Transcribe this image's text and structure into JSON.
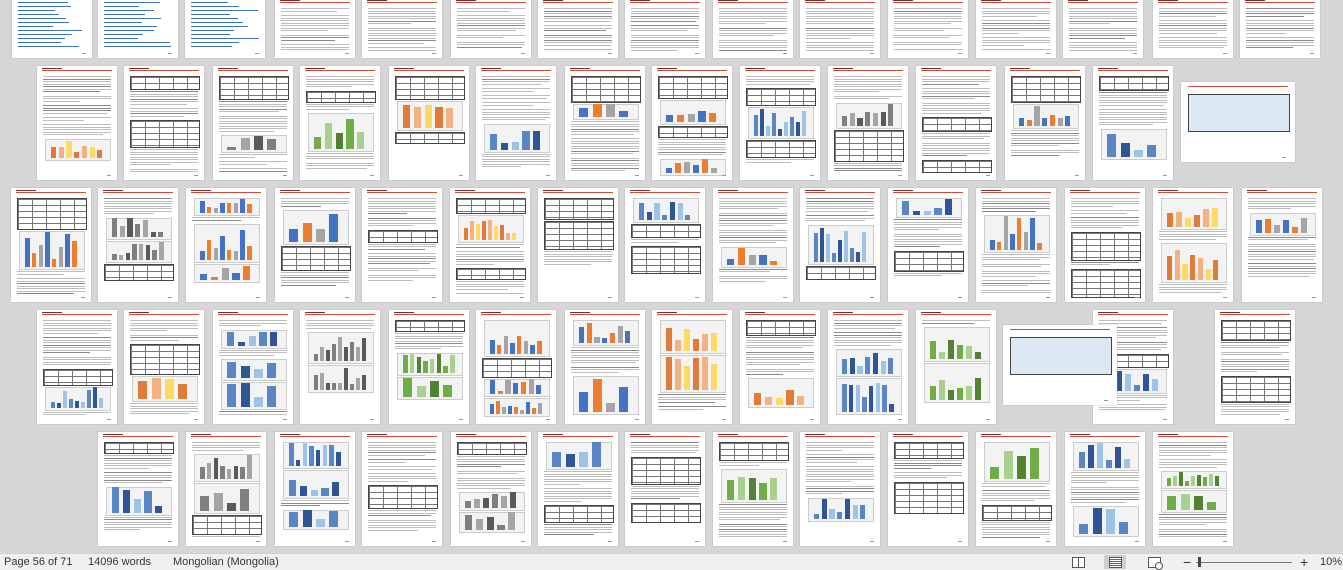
{
  "document_view": {
    "mode": "multi-page print layout",
    "accent_color": "#d04a3a"
  },
  "statusbar": {
    "page_info": "Page 56 of 71",
    "word_count": "14096 words",
    "language": "Mongolian (Mongolia)",
    "zoom_minus": "−",
    "zoom_plus": "+",
    "zoom_level": "10%",
    "views": [
      {
        "name": "read-mode",
        "icon": "book-icon"
      },
      {
        "name": "print-layout",
        "icon": "page-lines-icon",
        "selected": true
      },
      {
        "name": "web-layout",
        "icon": "web-page-icon"
      }
    ]
  }
}
